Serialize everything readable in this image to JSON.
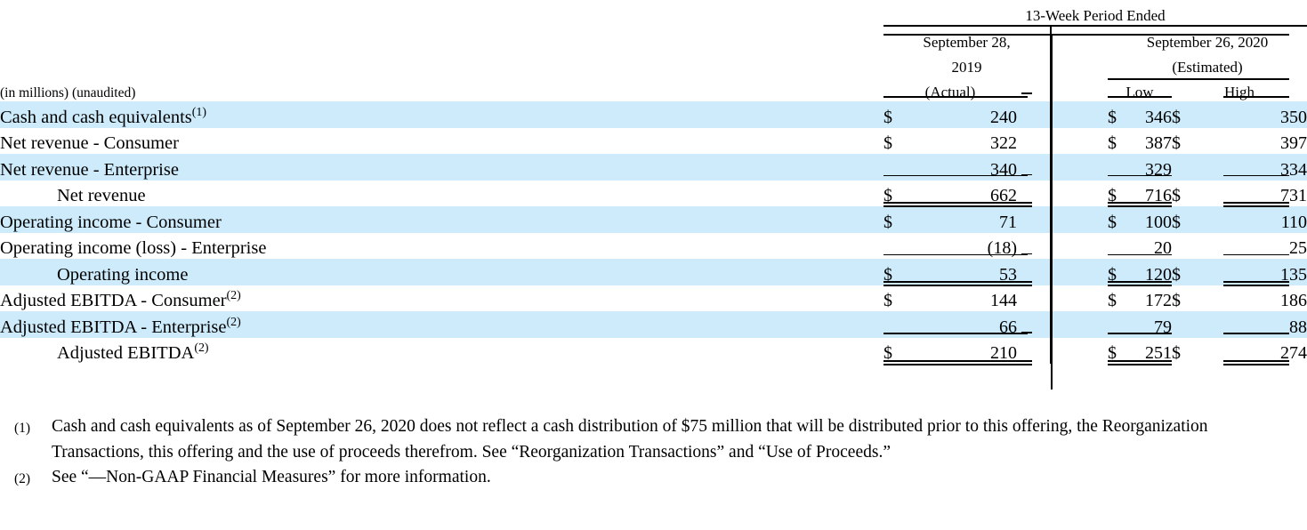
{
  "table": {
    "units_note": "(in millions) (unaudited)",
    "header": {
      "period_span": "13-Week Period Ended",
      "col_2019_line1": "September 28,",
      "col_2019_line2": "2019",
      "col_2019_line3": "(Actual)",
      "col_2020_line1": "September 26, 2020",
      "col_2020_line2": "(Estimated)",
      "low_label": "Low",
      "high_label": "High"
    },
    "rows": [
      {
        "label": "Cash and cash equivalents",
        "footnote": "(1)",
        "indent": false,
        "shaded": true,
        "rule": "none",
        "actual_cur": "$",
        "actual_val": "240",
        "low_cur": "$",
        "low_val": "346",
        "high_cur": "$",
        "high_val": "350"
      },
      {
        "label": "Net revenue - Consumer",
        "footnote": "",
        "indent": false,
        "shaded": false,
        "rule": "none",
        "actual_cur": "$",
        "actual_val": "322",
        "low_cur": "$",
        "low_val": "387",
        "high_cur": "$",
        "high_val": "397"
      },
      {
        "label": "Net revenue - Enterprise",
        "footnote": "",
        "indent": false,
        "shaded": true,
        "rule": "underline",
        "actual_cur": "",
        "actual_val": "340",
        "low_cur": "",
        "low_val": "329",
        "high_cur": "",
        "high_val": "334"
      },
      {
        "label": "Net revenue",
        "footnote": "",
        "indent": true,
        "shaded": false,
        "rule": "double",
        "actual_cur": "$",
        "actual_val": "662",
        "low_cur": "$",
        "low_val": "716",
        "high_cur": "$",
        "high_val": "731"
      },
      {
        "label": "Operating income - Consumer",
        "footnote": "",
        "indent": false,
        "shaded": true,
        "rule": "none",
        "actual_cur": "$",
        "actual_val": "71",
        "low_cur": "$",
        "low_val": "100",
        "high_cur": "$",
        "high_val": "110"
      },
      {
        "label": "Operating income (loss) - Enterprise",
        "footnote": "",
        "indent": false,
        "shaded": false,
        "rule": "underline",
        "actual_cur": "",
        "actual_val": "(18)",
        "low_cur": "",
        "low_val": "20",
        "high_cur": "",
        "high_val": "25"
      },
      {
        "label": "Operating income",
        "footnote": "",
        "indent": true,
        "shaded": true,
        "rule": "double",
        "actual_cur": "$",
        "actual_val": "53",
        "low_cur": "$",
        "low_val": "120",
        "high_cur": "$",
        "high_val": "135"
      },
      {
        "label": "Adjusted EBITDA - Consumer",
        "footnote": "(2)",
        "indent": false,
        "shaded": false,
        "rule": "none",
        "actual_cur": "$",
        "actual_val": "144",
        "low_cur": "$",
        "low_val": "172",
        "high_cur": "$",
        "high_val": "186"
      },
      {
        "label": "Adjusted EBITDA - Enterprise",
        "footnote": "(2)",
        "indent": false,
        "shaded": true,
        "rule": "underline",
        "actual_cur": "",
        "actual_val": "66",
        "low_cur": "",
        "low_val": "79",
        "high_cur": "",
        "high_val": "88"
      },
      {
        "label": "Adjusted EBITDA",
        "footnote": "(2)",
        "indent": true,
        "shaded": false,
        "rule": "double",
        "actual_cur": "$",
        "actual_val": "210",
        "low_cur": "$",
        "low_val": "251",
        "high_cur": "$",
        "high_val": "274"
      }
    ]
  },
  "footnotes": [
    {
      "mark": "(1)",
      "text": "Cash and cash equivalents as of September 26, 2020 does not reflect a cash distribution of $75 million that will be distributed prior to this offering, the Reorganization Transactions, this offering and the use of proceeds therefrom. See “Reorganization Transactions” and “Use of Proceeds.”"
    },
    {
      "mark": "(2)",
      "text": "See “—Non-GAAP Financial Measures” for more information."
    }
  ],
  "colors": {
    "row_shade": "#cdebfb",
    "rule": "#000000",
    "text": "#000000",
    "page_background": "#ffffff"
  }
}
